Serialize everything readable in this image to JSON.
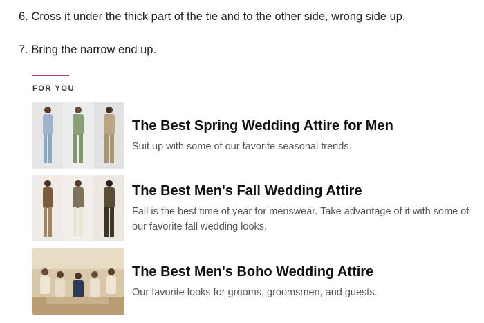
{
  "steps": [
    {
      "num": "6.",
      "text": "Cross it under the thick part of the tie and to the other side, wrong side up."
    },
    {
      "num": "7.",
      "text": "Bring the narrow end up."
    }
  ],
  "for_you": {
    "label": "FOR YOU",
    "accent_color": "#c2398f",
    "cards": [
      {
        "title": "The Best Spring Wedding Attire for Men",
        "description": "Suit up with some of our favorite seasonal trends.",
        "image": "three-men-spring-suits-photo"
      },
      {
        "title": "The Best Men's Fall Wedding Attire",
        "description": "Fall is the best time of year for menswear. Take advantage of it with some of our favorite fall wedding looks.",
        "image": "three-men-fall-suits-photo"
      },
      {
        "title": "The Best Men's Boho Wedding Attire",
        "description": "Our favorite looks for grooms, groomsmen, and guests.",
        "image": "boho-groomsmen-group-photo"
      }
    ]
  }
}
